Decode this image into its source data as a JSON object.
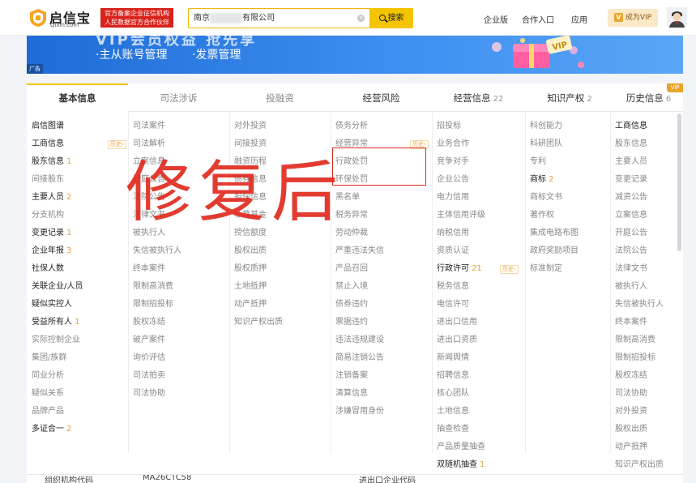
{
  "header": {
    "logo_cn": "启信宝",
    "logo_en": "Qixin.com",
    "slogan_line1": "官方备案企业征信机构",
    "slogan_line2": "人民数据官方合作伙伴",
    "search_value_prefix": "南京",
    "search_value_suffix": "有限公司",
    "search_button": "搜索",
    "nav": [
      "企业版",
      "合作入口",
      "应用"
    ],
    "vip_button": "成为VIP",
    "vip_mark": "V"
  },
  "banner": {
    "headline": "VIP会员权益 抢先享",
    "features": [
      "·主从账号管理",
      "·发票管理"
    ],
    "ad_tag": "广告",
    "gift_label": "VIP"
  },
  "tabs": [
    {
      "label": "基本信息",
      "count": ""
    },
    {
      "label": "司法涉诉",
      "count": ""
    },
    {
      "label": "投融资",
      "count": ""
    },
    {
      "label": "经营风险",
      "count": ""
    },
    {
      "label": "经营信息",
      "count": "22"
    },
    {
      "label": "知识产权",
      "count": "2"
    },
    {
      "label": "历史信息",
      "count": "6"
    }
  ],
  "vip_corner": "VIP",
  "history_tag": "历史",
  "columns": [
    {
      "items": [
        {
          "label": "启信图谱",
          "count": "",
          "style": "bold"
        },
        {
          "label": "工商信息",
          "count": "",
          "style": "bold",
          "history": true
        },
        {
          "label": "股东信息",
          "count": "1",
          "style": "bold"
        },
        {
          "label": "间接股东",
          "count": "",
          "style": "muted"
        },
        {
          "label": "主要人员",
          "count": "2",
          "style": "bold"
        },
        {
          "label": "分支机构",
          "count": "",
          "style": "muted"
        },
        {
          "label": "变更记录",
          "count": "1",
          "style": "bold"
        },
        {
          "label": "企业年报",
          "count": "3",
          "style": "bold"
        },
        {
          "label": "社保人数",
          "count": "",
          "style": "bold"
        },
        {
          "label": "关联企业/人员",
          "count": "",
          "style": "bold"
        },
        {
          "label": "疑似实控人",
          "count": "",
          "style": "bold"
        },
        {
          "label": "受益所有人",
          "count": "1",
          "style": "bold"
        },
        {
          "label": "实际控制企业",
          "count": "",
          "style": "muted"
        },
        {
          "label": "集团/族群",
          "count": "",
          "style": "muted"
        },
        {
          "label": "同业分析",
          "count": "",
          "style": "muted"
        },
        {
          "label": "疑似关系",
          "count": "",
          "style": "muted"
        },
        {
          "label": "品牌产品",
          "count": "",
          "style": "muted"
        },
        {
          "label": "多证合一",
          "count": "2",
          "style": "bold"
        }
      ]
    },
    {
      "items": [
        {
          "label": "司法案件",
          "count": "",
          "style": "muted"
        },
        {
          "label": "司法解析",
          "count": "",
          "style": "muted"
        },
        {
          "label": "立案信息",
          "count": "",
          "style": "muted"
        },
        {
          "label": "开庭公告",
          "count": "",
          "style": "muted"
        },
        {
          "label": "法院公告",
          "count": "",
          "style": "muted"
        },
        {
          "label": "法律文书",
          "count": "",
          "style": "muted"
        },
        {
          "label": "被执行人",
          "count": "",
          "style": "muted"
        },
        {
          "label": "失信被执行人",
          "count": "",
          "style": "muted"
        },
        {
          "label": "终本案件",
          "count": "",
          "style": "muted"
        },
        {
          "label": "限制高消费",
          "count": "",
          "style": "muted"
        },
        {
          "label": "限制招投标",
          "count": "",
          "style": "muted"
        },
        {
          "label": "股权冻结",
          "count": "",
          "style": "muted"
        },
        {
          "label": "破产案件",
          "count": "",
          "style": "muted"
        },
        {
          "label": "询价评估",
          "count": "",
          "style": "muted"
        },
        {
          "label": "司法拍卖",
          "count": "",
          "style": "muted"
        },
        {
          "label": "司法协助",
          "count": "",
          "style": "muted"
        }
      ]
    },
    {
      "items": [
        {
          "label": "对外投资",
          "count": "",
          "style": "muted"
        },
        {
          "label": "间接投资",
          "count": "",
          "style": "muted"
        },
        {
          "label": "融资历程",
          "count": "",
          "style": "muted"
        },
        {
          "label": "债券信息",
          "count": "",
          "style": "muted"
        },
        {
          "label": "担保信息",
          "count": "",
          "style": "muted"
        },
        {
          "label": "私募基金",
          "count": "",
          "style": "muted"
        },
        {
          "label": "授信额度",
          "count": "",
          "style": "muted"
        },
        {
          "label": "股权出质",
          "count": "",
          "style": "muted"
        },
        {
          "label": "股权质押",
          "count": "",
          "style": "muted"
        },
        {
          "label": "土地抵押",
          "count": "",
          "style": "muted"
        },
        {
          "label": "动产抵押",
          "count": "",
          "style": "muted"
        },
        {
          "label": "知识产权出质",
          "count": "",
          "style": "muted"
        }
      ]
    },
    {
      "items": [
        {
          "label": "债务分析",
          "count": "",
          "style": "muted"
        },
        {
          "label": "经营异常",
          "count": "",
          "style": "muted",
          "history": true
        },
        {
          "label": "行政处罚",
          "count": "",
          "style": "muted"
        },
        {
          "label": "环保处罚",
          "count": "",
          "style": "muted"
        },
        {
          "label": "黑名单",
          "count": "",
          "style": "muted"
        },
        {
          "label": "税务异常",
          "count": "",
          "style": "muted"
        },
        {
          "label": "劳动仲裁",
          "count": "",
          "style": "muted"
        },
        {
          "label": "严重违法失信",
          "count": "",
          "style": "muted"
        },
        {
          "label": "产品召回",
          "count": "",
          "style": "muted"
        },
        {
          "label": "禁止入境",
          "count": "",
          "style": "muted"
        },
        {
          "label": "债券违约",
          "count": "",
          "style": "muted"
        },
        {
          "label": "票据违约",
          "count": "",
          "style": "muted"
        },
        {
          "label": "违法违规建设",
          "count": "",
          "style": "muted"
        },
        {
          "label": "简易注销公告",
          "count": "",
          "style": "muted"
        },
        {
          "label": "注销备案",
          "count": "",
          "style": "muted"
        },
        {
          "label": "清算信息",
          "count": "",
          "style": "muted"
        },
        {
          "label": "涉嫌冒用身份",
          "count": "",
          "style": "muted"
        }
      ]
    },
    {
      "items": [
        {
          "label": "招投标",
          "count": "",
          "style": "muted"
        },
        {
          "label": "业务合作",
          "count": "",
          "style": "muted"
        },
        {
          "label": "竞争对手",
          "count": "",
          "style": "muted"
        },
        {
          "label": "企业公告",
          "count": "",
          "style": "muted"
        },
        {
          "label": "电力信用",
          "count": "",
          "style": "muted"
        },
        {
          "label": "主体信用评级",
          "count": "",
          "style": "muted"
        },
        {
          "label": "纳税信用",
          "count": "",
          "style": "muted"
        },
        {
          "label": "资质认证",
          "count": "",
          "style": "muted"
        },
        {
          "label": "行政许可",
          "count": "21",
          "style": "bold",
          "history": true
        },
        {
          "label": "税务信息",
          "count": "",
          "style": "muted"
        },
        {
          "label": "电信许可",
          "count": "",
          "style": "muted"
        },
        {
          "label": "进出口信用",
          "count": "",
          "style": "muted"
        },
        {
          "label": "进出口资质",
          "count": "",
          "style": "muted"
        },
        {
          "label": "新闻舆情",
          "count": "",
          "style": "muted"
        },
        {
          "label": "招聘信息",
          "count": "",
          "style": "muted"
        },
        {
          "label": "核心团队",
          "count": "",
          "style": "muted"
        },
        {
          "label": "土地信息",
          "count": "",
          "style": "muted"
        },
        {
          "label": "抽查检查",
          "count": "",
          "style": "muted"
        },
        {
          "label": "产品质量抽查",
          "count": "",
          "style": "muted"
        },
        {
          "label": "双随机抽查",
          "count": "1",
          "style": "bold"
        }
      ]
    },
    {
      "items": [
        {
          "label": "科创能力",
          "count": "",
          "style": "muted"
        },
        {
          "label": "科研团队",
          "count": "",
          "style": "muted"
        },
        {
          "label": "专利",
          "count": "",
          "style": "muted"
        },
        {
          "label": "商标",
          "count": "2",
          "style": "bold"
        },
        {
          "label": "商标文书",
          "count": "",
          "style": "muted"
        },
        {
          "label": "著作权",
          "count": "",
          "style": "muted"
        },
        {
          "label": "集成电路布图",
          "count": "",
          "style": "muted"
        },
        {
          "label": "政府奖励项目",
          "count": "",
          "style": "muted"
        },
        {
          "label": "标准制定",
          "count": "",
          "style": "muted"
        }
      ]
    },
    {
      "items": [
        {
          "label": "工商信息",
          "count": "",
          "style": "bold"
        },
        {
          "label": "股东信息",
          "count": "",
          "style": "muted"
        },
        {
          "label": "主要人员",
          "count": "",
          "style": "muted"
        },
        {
          "label": "变更记录",
          "count": "",
          "style": "muted"
        },
        {
          "label": "减资公告",
          "count": "",
          "style": "muted"
        },
        {
          "label": "立案信息",
          "count": "",
          "style": "muted"
        },
        {
          "label": "开庭公告",
          "count": "",
          "style": "muted"
        },
        {
          "label": "法院公告",
          "count": "",
          "style": "muted"
        },
        {
          "label": "法律文书",
          "count": "",
          "style": "muted"
        },
        {
          "label": "被执行人",
          "count": "",
          "style": "muted"
        },
        {
          "label": "失信被执行人",
          "count": "",
          "style": "muted"
        },
        {
          "label": "终本案件",
          "count": "",
          "style": "muted"
        },
        {
          "label": "限制高消费",
          "count": "",
          "style": "muted"
        },
        {
          "label": "限制招投标",
          "count": "",
          "style": "muted"
        },
        {
          "label": "股权冻结",
          "count": "",
          "style": "muted"
        },
        {
          "label": "司法协助",
          "count": "",
          "style": "muted"
        },
        {
          "label": "对外投资",
          "count": "",
          "style": "muted"
        },
        {
          "label": "股权出质",
          "count": "",
          "style": "muted"
        },
        {
          "label": "动产抵押",
          "count": "",
          "style": "muted"
        },
        {
          "label": "知识产权出质",
          "count": "",
          "style": "muted"
        }
      ]
    }
  ],
  "watermark": "修复后",
  "peek_row": [
    "组织机构代码",
    "MA26CTC58",
    "进出口企业代码"
  ],
  "colors": {
    "accent": "#f5c400",
    "count": "#e6a23c",
    "annotation_red": "#d92b1f"
  }
}
